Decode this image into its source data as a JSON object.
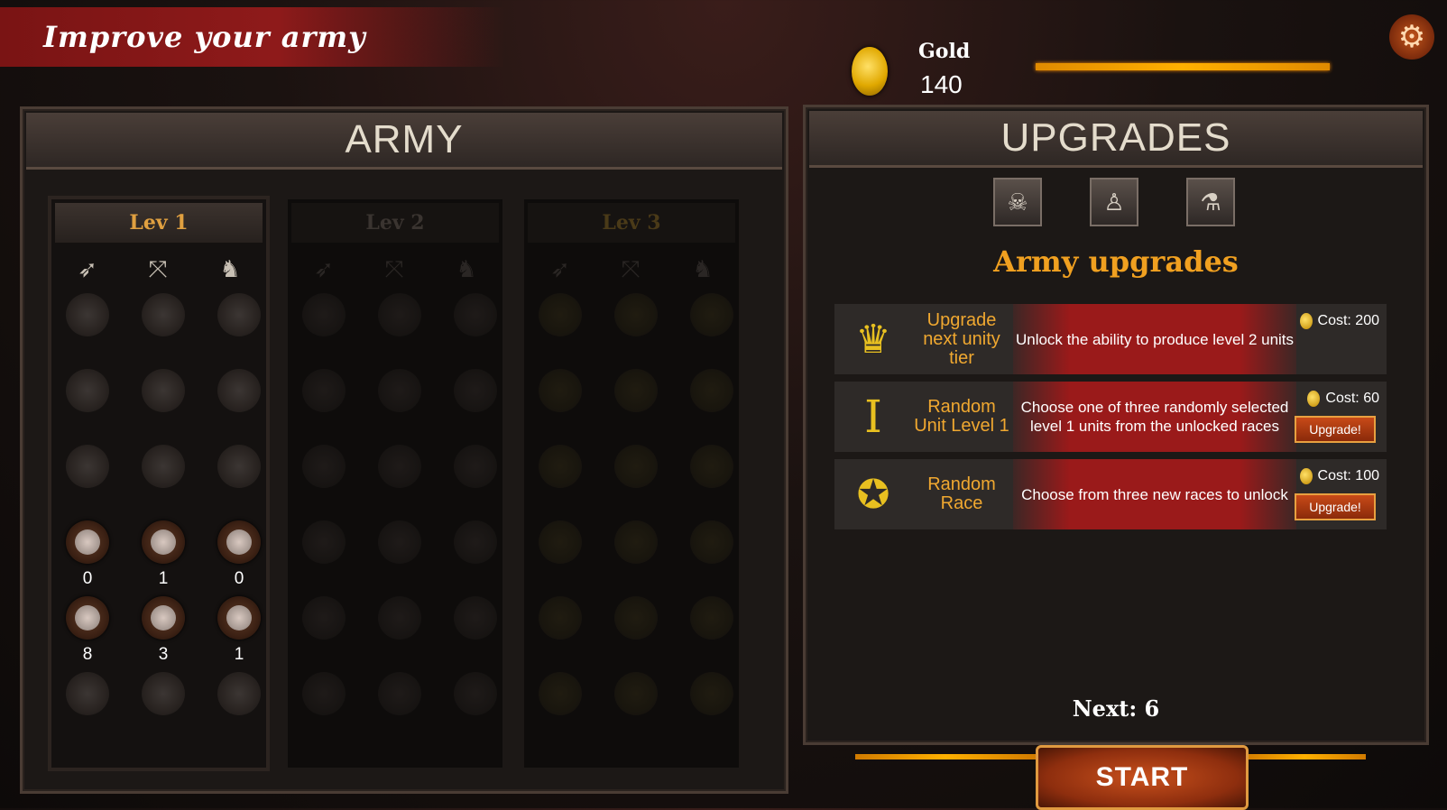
{
  "header": {
    "title": "Improve your army"
  },
  "gold": {
    "label": "Gold",
    "value": "140",
    "icon": "gold-coin-icon",
    "bar_fill": 1.0
  },
  "settings": {
    "icon": "gear-icon"
  },
  "army": {
    "title": "ARMY",
    "levels": [
      {
        "label": "Lev 1",
        "state": "unlocked"
      },
      {
        "label": "Lev 2",
        "state": "locked"
      },
      {
        "label": "Lev 3",
        "state": "locked"
      }
    ],
    "unit_type_icons": [
      "spear-icon",
      "crossbow-icon",
      "horse-icon"
    ],
    "level1_counts": {
      "row4": [
        "0",
        "1",
        "0"
      ],
      "row5": [
        "8",
        "3",
        "1"
      ]
    }
  },
  "upgrades": {
    "title": "UPGRADES",
    "tabs": [
      "skull-tab-icon",
      "figure-tab-icon",
      "bottles-tab-icon"
    ],
    "section_title": "Army upgrades",
    "items": [
      {
        "icon": "trophy-icon",
        "name": "Upgrade next unity tier",
        "description": "Unlock the ability to produce level 2 units",
        "cost": "Cost: 200",
        "button": ""
      },
      {
        "icon": "roman-one-icon",
        "name": "Random Unit Level 1",
        "description": "Choose one of three randomly selected level 1 units from the unlocked races",
        "cost": "Cost: 60",
        "button": "Upgrade!"
      },
      {
        "icon": "medal-icon",
        "name": "Random Race",
        "description": "Choose from three new races to unlock",
        "cost": "Cost: 100",
        "button": "Upgrade!"
      }
    ],
    "next_label": "Next: 6"
  },
  "start": {
    "label": "START"
  },
  "colors": {
    "accent_gold": "#f0a020",
    "banner_red": "#8e1a1a",
    "button_orange": "#c84a18"
  }
}
